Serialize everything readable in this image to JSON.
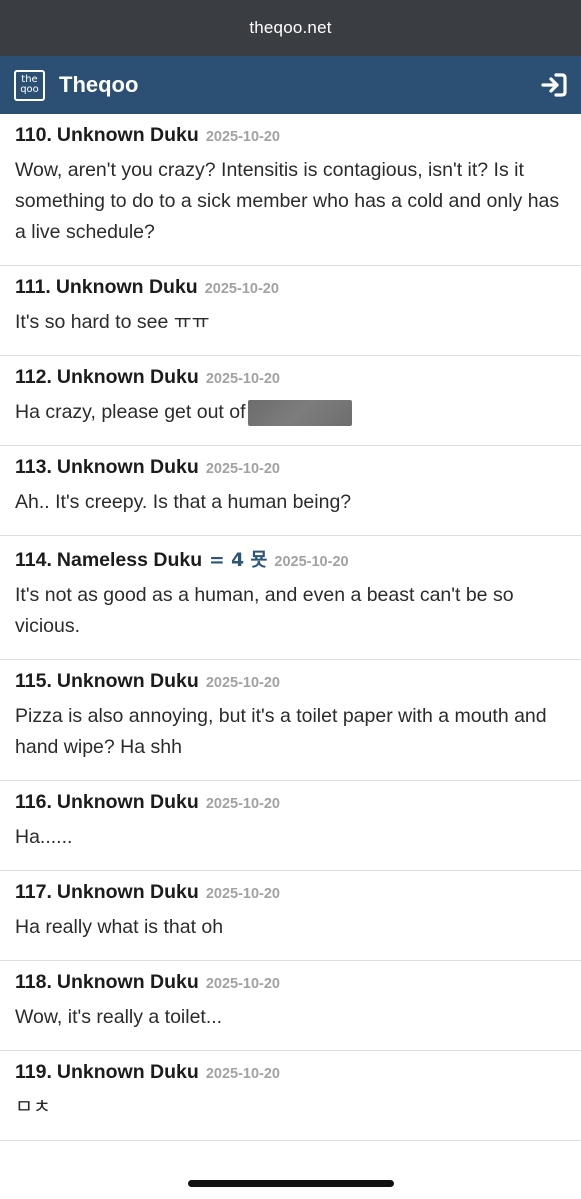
{
  "browser": {
    "url": "theqoo.net"
  },
  "header": {
    "logo_line1": "the",
    "logo_line2": "qoo",
    "title": "Theqoo"
  },
  "comments": [
    {
      "num": "110.",
      "name": "Unknown Duku",
      "badge": "",
      "date": "2025-10-20",
      "body": "Wow, aren't you crazy? Intensitis is contagious, isn't it? Is it something to do to a sick member who has a cold and only has a live schedule?"
    },
    {
      "num": "111.",
      "name": "Unknown Duku",
      "badge": "",
      "date": "2025-10-20",
      "body": "It's so hard to see ㅠㅠ"
    },
    {
      "num": "112.",
      "name": "Unknown Duku",
      "badge": "",
      "date": "2025-10-20",
      "body": "Ha crazy, please get out of"
    },
    {
      "num": "113.",
      "name": "Unknown Duku",
      "badge": "",
      "date": "2025-10-20",
      "body": "Ah.. It's creepy. Is that a human being?"
    },
    {
      "num": "114.",
      "name": "Nameless Duku",
      "badge": "= 4 묫",
      "date": "2025-10-20",
      "body": "It's not as good as a human, and even a beast can't be so vicious."
    },
    {
      "num": "115.",
      "name": "Unknown Duku",
      "badge": "",
      "date": "2025-10-20",
      "body": "Pizza is also annoying, but it's a toilet paper with a mouth and hand wipe? Ha shh"
    },
    {
      "num": "116.",
      "name": "Unknown Duku",
      "badge": "",
      "date": "2025-10-20",
      "body": "Ha......"
    },
    {
      "num": "117.",
      "name": "Unknown Duku",
      "badge": "",
      "date": "2025-10-20",
      "body": "Ha really what is that oh"
    },
    {
      "num": "118.",
      "name": "Unknown Duku",
      "badge": "",
      "date": "2025-10-20",
      "body": "Wow, it's really a toilet..."
    },
    {
      "num": "119.",
      "name": "Unknown Duku",
      "badge": "",
      "date": "2025-10-20",
      "body": "ㅁㅊ"
    }
  ],
  "colors": {
    "url_bar": "#3a3d42",
    "header": "#2c5074",
    "badge": "#2d5578",
    "date": "#a2a2a2"
  },
  "icons": {
    "logo": "theqoo-logo-icon",
    "login": "login-arrow-icon"
  }
}
